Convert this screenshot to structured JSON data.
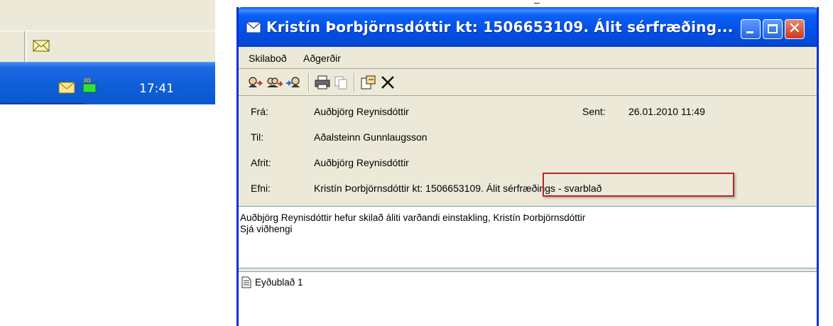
{
  "tray": {
    "clock": "17:41",
    "icons": [
      "envelope-icon",
      "network-status-icon"
    ]
  },
  "window": {
    "title": "Kristín Þorbjörnsdóttir kt: 1506653109. Álit sérfræðing...",
    "title_icon": "envelope-icon"
  },
  "menu": {
    "items": [
      "Skilaboð",
      "Aðgerðir"
    ]
  },
  "toolbar": {
    "buttons": [
      "reply-icon",
      "reply-all-icon",
      "forward-icon",
      "print-icon",
      "copy-icon",
      "attachment-icon",
      "delete-icon"
    ]
  },
  "header": {
    "from_label": "Frá:",
    "from_value": "Auðbjörg Reynisdóttir",
    "sent_label": "Sent:",
    "sent_value": "26.01.2010 11:49",
    "to_label": "Til:",
    "to_value": "Aðalsteinn Gunnlaugsson",
    "cc_label": "Afrit:",
    "cc_value": "Auðbjörg Reynisdóttir",
    "subject_label": "Efni:",
    "subject_value": "Kristín Þorbjörnsdóttir kt: 1506653109. Álit sérfræðings - svarblað"
  },
  "body": {
    "lines": [
      "Auðbjörg Reynisdóttir hefur skilað áliti varðandi einstakling, Kristín Þorbjörnsdóttir",
      "Sjá viðhengi"
    ]
  },
  "attachments": [
    {
      "name": "Eyðublað 1",
      "icon": "document-icon"
    }
  ],
  "colors": {
    "titlebar": "#0350e6",
    "window_chrome": "#ece9d8",
    "highlight_border": "#b8262d",
    "taskbar": "#0e5fd8"
  }
}
